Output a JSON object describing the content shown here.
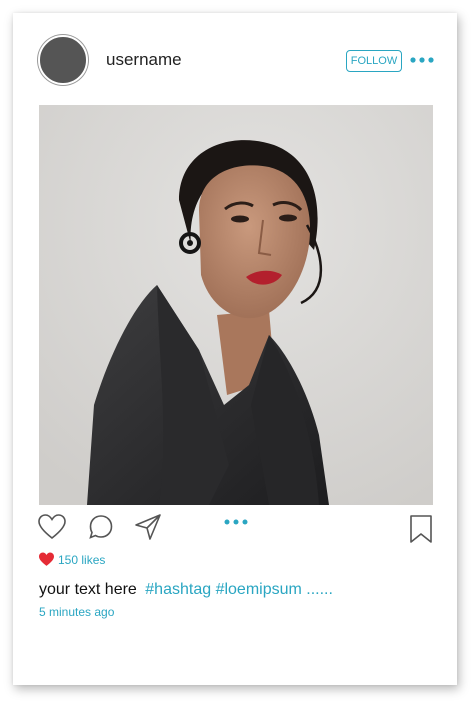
{
  "post": {
    "username": "username",
    "follow_label": "FOLLOW",
    "likes_text": "150 likes",
    "caption_text": "your text here",
    "hashtags": "#hashtag #loemipsum ......",
    "time_text": "5 minutes ago"
  },
  "icons": {
    "more": "more-dots-icon",
    "like": "heart-outline-icon",
    "comment": "comment-bubble-icon",
    "share": "paper-plane-icon",
    "carousel": "carousel-dots-icon",
    "bookmark": "bookmark-icon",
    "liked": "heart-filled-icon"
  },
  "colors": {
    "accent": "#2aa6c2",
    "like_red": "#e52b35",
    "avatar": "#555555",
    "icon_gray": "#555555"
  }
}
